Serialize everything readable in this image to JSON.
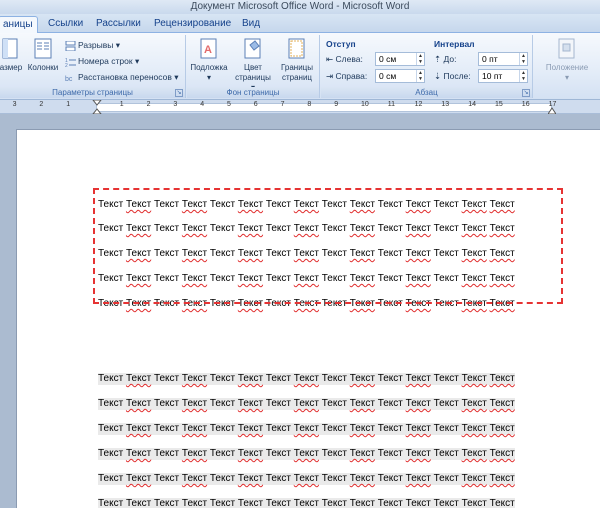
{
  "window": {
    "title": "Документ Microsoft Office Word - Microsoft Word"
  },
  "tabs": [
    {
      "label": "аницы",
      "active": true
    },
    {
      "label": "Ссылки",
      "active": false
    },
    {
      "label": "Рассылки",
      "active": false
    },
    {
      "label": "Рецензирование",
      "active": false
    },
    {
      "label": "Вид",
      "active": false
    }
  ],
  "ribbon": {
    "page_setup": {
      "label": "Параметры страницы",
      "size_button": "азмер",
      "columns_button": "Колонки",
      "breaks": "Разрывы",
      "line_numbers": "Номера строк",
      "hyphenation": "Расстановка переносов"
    },
    "page_background": {
      "label": "Фон страницы",
      "watermark": "Подложка",
      "page_color_1": "Цвет",
      "page_color_2": "страницы",
      "page_borders_1": "Границы",
      "page_borders_2": "страниц"
    },
    "paragraph": {
      "label": "Абзац",
      "indent_title": "Отступ",
      "left_label": "Слева:",
      "left_value": "0 см",
      "right_label": "Справа:",
      "right_value": "0 см",
      "spacing_title": "Интервал",
      "before_label": "До:",
      "before_value": "0 пт",
      "after_label": "После:",
      "after_value": "10 пт"
    },
    "arrange": {
      "position": "Положение"
    }
  },
  "ruler": {
    "numbers": [
      "3",
      "2",
      "1",
      "1",
      "2",
      "3",
      "4",
      "5",
      "6",
      "7",
      "8",
      "9",
      "10",
      "11",
      "12",
      "13",
      "14",
      "15",
      "16",
      "17"
    ]
  },
  "document": {
    "word": "Текст",
    "words_per_line": 15,
    "spellcheck_pattern": [
      false,
      true,
      false,
      true,
      false,
      true,
      false,
      true,
      false,
      true,
      false,
      true,
      false,
      true,
      true
    ],
    "selected_paragraphs": 5,
    "plain_paragraphs": 6
  },
  "colors": {
    "selection_frame": "#e63333",
    "spelling_underline": "#e02b2b",
    "paragraph_shading": "#eaeaea",
    "ribbon_text": "#1e395b"
  }
}
